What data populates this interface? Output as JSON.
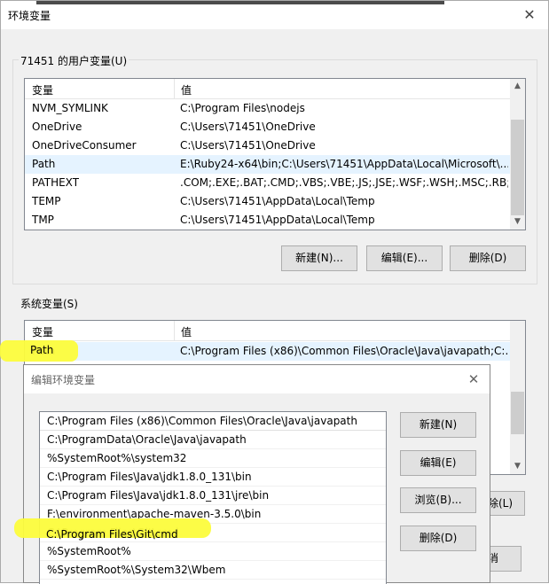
{
  "outer_dialog": {
    "title": "环境变量",
    "close_glyph": "✕",
    "user_vars": {
      "group_label": "71451 的用户变量(U)",
      "columns": [
        "变量",
        "值"
      ],
      "rows": [
        {
          "name": "NVM_SYMLINK",
          "value": "C:\\Program Files\\nodejs"
        },
        {
          "name": "OneDrive",
          "value": "C:\\Users\\71451\\OneDrive"
        },
        {
          "name": "OneDriveConsumer",
          "value": "C:\\Users\\71451\\OneDrive"
        },
        {
          "name": "Path",
          "value": "E:\\Ruby24-x64\\bin;C:\\Users\\71451\\AppData\\Local\\Microsoft\\..."
        },
        {
          "name": "PATHEXT",
          "value": ".COM;.EXE;.BAT;.CMD;.VBS;.VBE;.JS;.JSE;.WSF;.WSH;.MSC;.RB;..."
        },
        {
          "name": "TEMP",
          "value": "C:\\Users\\71451\\AppData\\Local\\Temp"
        },
        {
          "name": "TMP",
          "value": "C:\\Users\\71451\\AppData\\Local\\Temp"
        }
      ],
      "selected_index": 3,
      "buttons": {
        "new": "新建(N)...",
        "edit": "编辑(E)...",
        "delete": "删除(D)"
      }
    },
    "system_vars": {
      "group_label": "系统变量(S)",
      "columns": [
        "变量",
        "值"
      ],
      "rows": [
        {
          "name": "Path",
          "value": "C:\\Program Files (x86)\\Common Files\\Oracle\\Java\\javapath;C:..."
        }
      ],
      "partial_delete_label": "除(L)",
      "partial_ok_label": "消"
    }
  },
  "edit_dialog": {
    "title": "编辑环境变量",
    "close_glyph": "✕",
    "paths": [
      "C:\\Program Files (x86)\\Common Files\\Oracle\\Java\\javapath",
      "C:\\ProgramData\\Oracle\\Java\\javapath",
      "%SystemRoot%\\system32",
      "C:\\Program Files\\Java\\jdk1.8.0_131\\bin",
      "C:\\Program Files\\Java\\jdk1.8.0_131\\jre\\bin",
      "F:\\environment\\apache-maven-3.5.0\\bin",
      "C:\\Program Files\\Git\\cmd",
      "%SystemRoot%",
      "%SystemRoot%\\System32\\Wbem"
    ],
    "buttons": {
      "new": "新建(N)",
      "edit": "编辑(E)",
      "browse": "浏览(B)...",
      "delete": "删除(D)"
    }
  },
  "colors": {
    "highlight": "#fcfc3c",
    "selected_row": "#e5f3ff"
  }
}
